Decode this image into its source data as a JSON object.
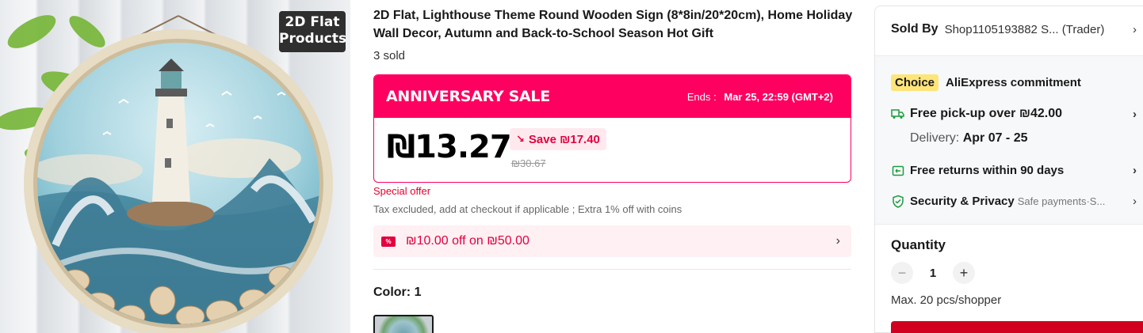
{
  "product": {
    "title": "2D Flat, Lighthouse Theme Round Wooden Sign (8*8in/20*20cm), Home Holiday Wall Decor, Autumn and Back-to-School Season Hot Gift",
    "sold": "3 sold",
    "image_badge_line1": "2D Flat",
    "image_badge_line2": "Products"
  },
  "sale": {
    "title": "ANNIVERSARY SALE",
    "ends_label": "Ends :",
    "ends_value": "Mar 25, 22:59 (GMT+2)",
    "price": "₪13.27",
    "save": "Save ₪17.40",
    "original_price": "₪30.67",
    "accent_color": "#fd0060"
  },
  "offers": {
    "special": "Special offer",
    "tax_note": "Tax excluded, add at checkout if applicable ; Extra 1% off with coins",
    "coupon": "₪10.00 off on ₪50.00",
    "coupon_icon": "%"
  },
  "color": {
    "label": "Color:",
    "value": "1"
  },
  "seller": {
    "label": "Sold By",
    "value": "Shop1105193882 S... (Trader)"
  },
  "choice": {
    "badge": "Choice",
    "text": "AliExpress commitment",
    "shipping": "Free pick-up over ₪42.00",
    "delivery_label": "Delivery:",
    "delivery_value": "Apr 07 - 25",
    "returns": "Free returns within 90 days",
    "security": "Security & Privacy",
    "security_sub": "Safe payments·S..."
  },
  "quantity": {
    "label": "Quantity",
    "value": "1",
    "max": "Max. 20 pcs/shopper",
    "minus": "−",
    "plus": "+"
  },
  "icons": {
    "chevron": "›",
    "truck": "truck-icon",
    "return": "return-icon",
    "shield": "shield-icon"
  }
}
